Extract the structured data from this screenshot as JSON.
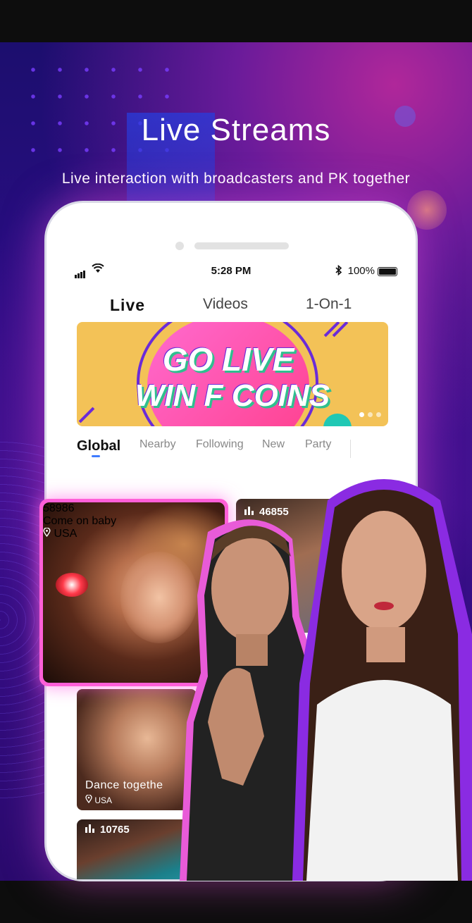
{
  "hero": {
    "title": "Live Streams",
    "subtitle": "Live interaction with broadcasters and PK together"
  },
  "status_bar": {
    "time": "5:28 PM",
    "battery": "100%",
    "bluetooth_glyph": "∗"
  },
  "top_tabs": [
    {
      "label": "Live",
      "active": true
    },
    {
      "label": "Videos",
      "active": false
    },
    {
      "label": "1-On-1",
      "active": false
    }
  ],
  "banner": {
    "line1": "GO LIVE",
    "line2": "WIN F COINS",
    "page_count": 3,
    "active_page": 1
  },
  "sub_tabs": [
    {
      "label": "Global",
      "active": true
    },
    {
      "label": "Nearby",
      "active": false
    },
    {
      "label": "Following",
      "active": false
    },
    {
      "label": "New",
      "active": false
    },
    {
      "label": "Party",
      "active": false
    }
  ],
  "streams": [
    {
      "viewers": "58986",
      "title": "Come on baby",
      "location": "USA",
      "featured": true
    },
    {
      "viewers": "46855",
      "title": "",
      "location": ""
    },
    {
      "viewers": "",
      "title": "Dance togethe",
      "location": "USA"
    },
    {
      "viewers": "10765",
      "title": "",
      "location": ""
    }
  ],
  "colors": {
    "accent_pink": "#ff5fd8",
    "tab_indicator": "#3f7bff",
    "background_purple": "#2a0d83"
  },
  "icons": {
    "viewers": "bar-chart-icon",
    "location": "location-pin-icon",
    "wifi": "wifi-icon",
    "signal": "cellular-signal-icon",
    "battery": "battery-icon",
    "bluetooth": "bluetooth-icon"
  }
}
